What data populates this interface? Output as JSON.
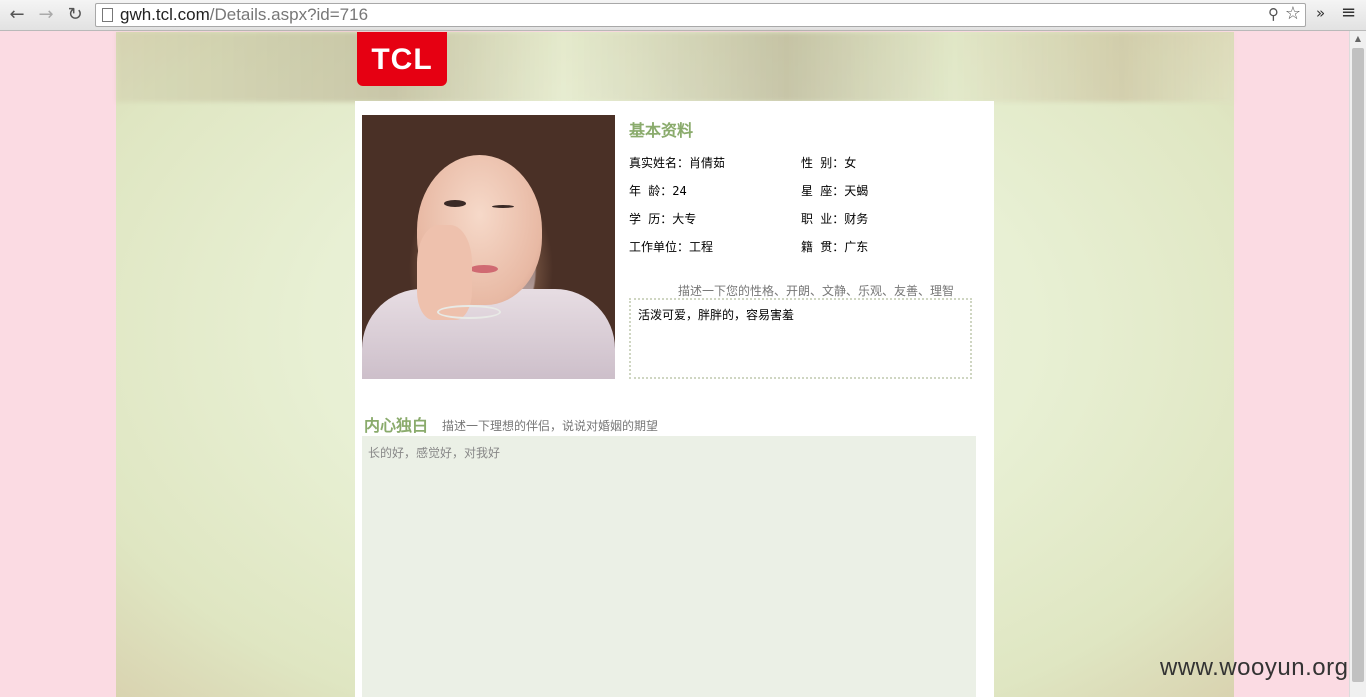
{
  "browser": {
    "url_host": "gwh.tcl.com",
    "url_path": "/Details.aspx?id=716",
    "back_icon": "←",
    "forward_icon": "→",
    "reload_icon": "↻",
    "zoom_icon": "⚲",
    "star_icon": "☆",
    "extensions_icon": "»",
    "menu_icon": "≡"
  },
  "logo": {
    "text": "TCL"
  },
  "basic": {
    "title": "基本资料",
    "real_name": "真实姓名：肖倩茹",
    "gender": "性  别：女",
    "age": "年  龄：24",
    "zodiac": "星  座：天蝎",
    "education": "学  历：大专",
    "occupation": "职  业：财务",
    "workplace": "工作单位：工程",
    "hometown": "籍  贯：广东"
  },
  "personality": {
    "hint": "描述一下您的性格、开朗、文静、乐观、友善、理智",
    "text": "活泼可爱，胖胖的，容易害羞"
  },
  "inner": {
    "title": "内心独白",
    "hint": "描述一下理想的伴侣，说说对婚姻的期望",
    "text": "长的好，感觉好，对我好"
  },
  "watermark": "www.wooyun.org"
}
